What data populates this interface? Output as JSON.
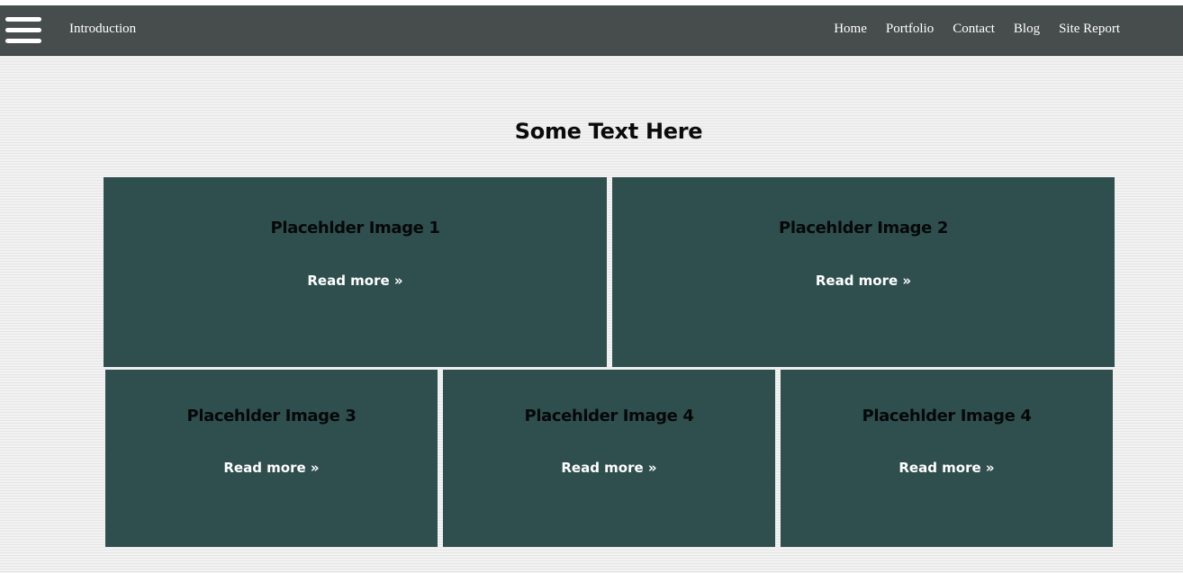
{
  "navbar": {
    "menu_icon": "hamburger-menu-icon",
    "brand": "Introduction",
    "links": [
      "Home",
      "Portfolio",
      "Contact",
      "Blog",
      "Site Report"
    ]
  },
  "main": {
    "heading": "Some Text Here",
    "cards": [
      {
        "title": "Placehlder Image 1",
        "link": "Read more »"
      },
      {
        "title": "Placehlder Image 2",
        "link": "Read more »"
      },
      {
        "title": "Placehlder Image 3",
        "link": "Read more »"
      },
      {
        "title": "Placehlder Image 4",
        "link": "Read more »"
      },
      {
        "title": "Placehlder Image 4",
        "link": "Read more »"
      }
    ]
  },
  "colors": {
    "navbar_bg": "#474d4d",
    "card_bg": "#2f4f4f",
    "page_bg": "#efefef",
    "nav_text": "#ffffff"
  }
}
